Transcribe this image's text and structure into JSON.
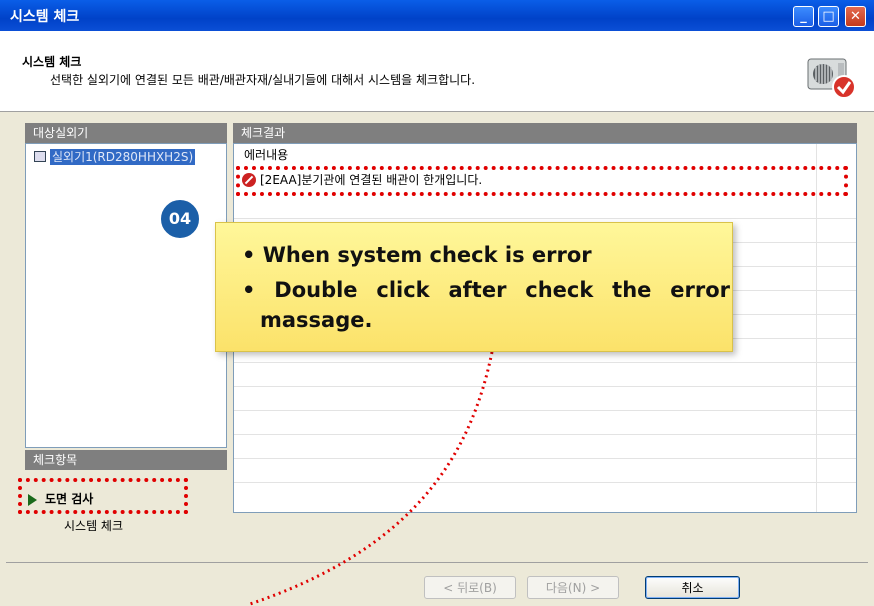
{
  "window": {
    "title": "시스템 체크",
    "controls": {
      "minimize": "_",
      "maximize": "□",
      "close": "✕"
    }
  },
  "header": {
    "title": "시스템 체크",
    "description": "선택한 실외기에 연결된 모든 배관/배관자재/실내기들에 대해서 시스템을 체크합니다.",
    "icon": "outdoor-unit-check-icon"
  },
  "left_panel": {
    "target_header": "대상실외기",
    "outdoor_units": [
      "실외기1(RD280HHXH2S)"
    ],
    "check_header": "체크항목",
    "check_items": [
      "도면 검사",
      "시스템 체크"
    ]
  },
  "results": {
    "header": "체크결과",
    "column": "에러내용",
    "errors": [
      "[2EAA]분기관에 연결된 배관이 한개입니다."
    ]
  },
  "buttons": {
    "back": "< 뒤로(B)",
    "next": "다음(N) >",
    "cancel": "취소"
  },
  "annotation": {
    "badge": "04",
    "bullet1": "• When system check is error",
    "bullet2": "• Double click after check the error massage.",
    "highlight_color": "#e00000",
    "badge_color": "#1b5fa8",
    "callout_color": "#fbe26a"
  }
}
